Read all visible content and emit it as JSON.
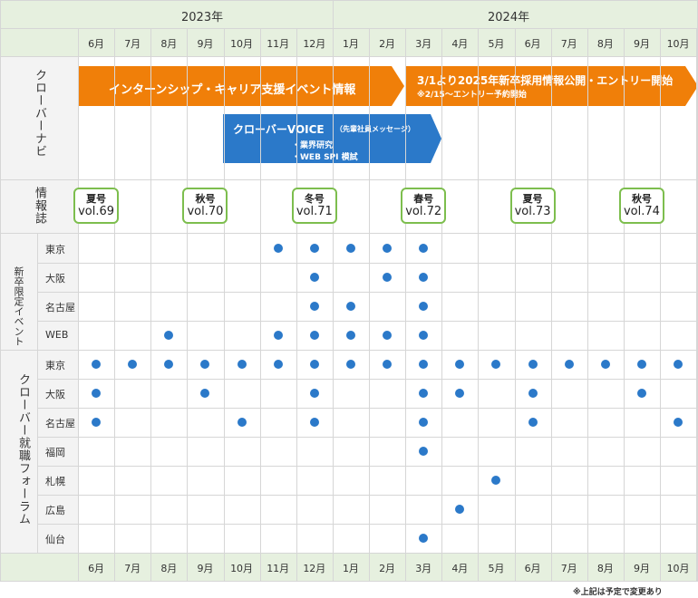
{
  "years": [
    {
      "label": "2023年"
    },
    {
      "label": "2024年"
    }
  ],
  "months": [
    "6月",
    "7月",
    "8月",
    "9月",
    "10月",
    "11月",
    "12月",
    "1月",
    "2月",
    "3月",
    "4月",
    "5月",
    "6月",
    "7月",
    "8月",
    "9月",
    "10月"
  ],
  "sections": {
    "navi": "クローバーナビ",
    "magazine": "情報誌",
    "event": "新卒限定イベント",
    "forum": "クローバー就職フォーラム"
  },
  "navi_bars": {
    "internship": "インターンシップ・キャリア支援イベント情報",
    "recruit_main": "3/1より2025年新卒採用情報公開・エントリー開始",
    "recruit_sub": "※2/15〜エントリー予約開始",
    "voice_title": "クローバーVOICE",
    "voice_paren": "（先輩社員メッセージ）",
    "voice_item1": "・業界研究",
    "voice_item2": "・WEB SPI 模試"
  },
  "magazines": [
    {
      "season": "夏号",
      "vol": "vol.69",
      "col": 0.5
    },
    {
      "season": "秋号",
      "vol": "vol.70",
      "col": 3.5
    },
    {
      "season": "冬号",
      "vol": "vol.71",
      "col": 6.5
    },
    {
      "season": "春号",
      "vol": "vol.72",
      "col": 9.5
    },
    {
      "season": "夏号",
      "vol": "vol.73",
      "col": 12.5
    },
    {
      "season": "秋号",
      "vol": "vol.74",
      "col": 15.5
    }
  ],
  "event_rows": [
    {
      "city": "東京",
      "dots": [
        5,
        6,
        7,
        8,
        9
      ]
    },
    {
      "city": "大阪",
      "dots": [
        6,
        8,
        9
      ]
    },
    {
      "city": "名古屋",
      "dots": [
        6,
        7,
        9
      ]
    },
    {
      "city": "WEB",
      "dots": [
        2,
        5,
        6,
        7,
        8,
        9
      ]
    }
  ],
  "forum_rows": [
    {
      "city": "東京",
      "dots": [
        0,
        1,
        2,
        3,
        4,
        5,
        6,
        7,
        8,
        9,
        10,
        11,
        12,
        13,
        14,
        15,
        16
      ]
    },
    {
      "city": "大阪",
      "dots": [
        0,
        3,
        6,
        9,
        10,
        12,
        15
      ]
    },
    {
      "city": "名古屋",
      "dots": [
        0,
        4,
        6,
        9,
        12,
        16
      ]
    },
    {
      "city": "福岡",
      "dots": [
        9
      ]
    },
    {
      "city": "札幌",
      "dots": [
        11
      ]
    },
    {
      "city": "広島",
      "dots": [
        10
      ]
    },
    {
      "city": "仙台",
      "dots": [
        9
      ]
    }
  ],
  "footnote": "※上記は予定で変更あり",
  "colors": {
    "orange": "#f07f09",
    "blue": "#2b79c9",
    "green": "#7dbe4e",
    "header": "#e6f0df"
  }
}
